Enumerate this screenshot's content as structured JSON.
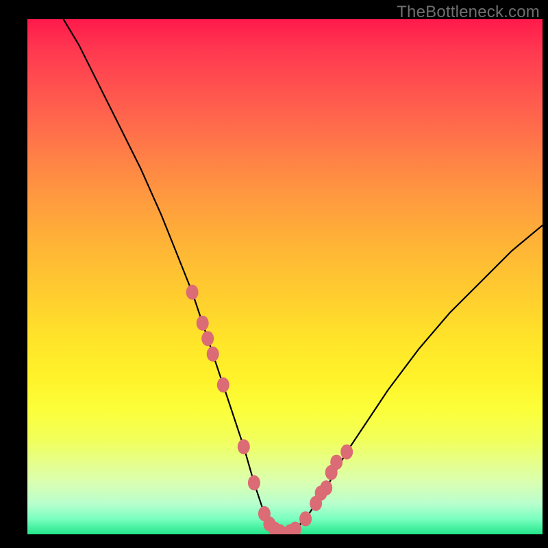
{
  "watermark": "TheBottleneck.com",
  "chart_data": {
    "type": "line",
    "title": "",
    "xlabel": "",
    "ylabel": "",
    "xlim": [
      0,
      100
    ],
    "ylim": [
      0,
      100
    ],
    "grid": false,
    "series": [
      {
        "name": "curve",
        "x": [
          7,
          10,
          14,
          18,
          22,
          26,
          28,
          30,
          32,
          34,
          36,
          38,
          40,
          42,
          44,
          45,
          46,
          48,
          50,
          52,
          54,
          56,
          58,
          62,
          66,
          70,
          76,
          82,
          88,
          94,
          100
        ],
        "values": [
          100,
          95,
          87,
          79,
          71,
          62,
          57,
          52,
          47,
          41,
          35,
          29,
          23,
          17,
          10,
          7,
          4,
          1,
          0,
          1,
          3,
          6,
          9,
          16,
          22,
          28,
          36,
          43,
          49,
          55,
          60
        ]
      }
    ],
    "markers": {
      "name": "highlighted-points",
      "x": [
        32,
        34,
        35,
        36,
        38,
        42,
        44,
        46,
        47,
        48,
        49,
        50,
        51,
        52,
        54,
        56,
        57,
        58,
        59,
        60,
        62
      ],
      "values": [
        47,
        41,
        38,
        35,
        29,
        17,
        10,
        4,
        2,
        1,
        0.5,
        0,
        0.5,
        1,
        3,
        6,
        8,
        9,
        12,
        14,
        16
      ]
    }
  }
}
